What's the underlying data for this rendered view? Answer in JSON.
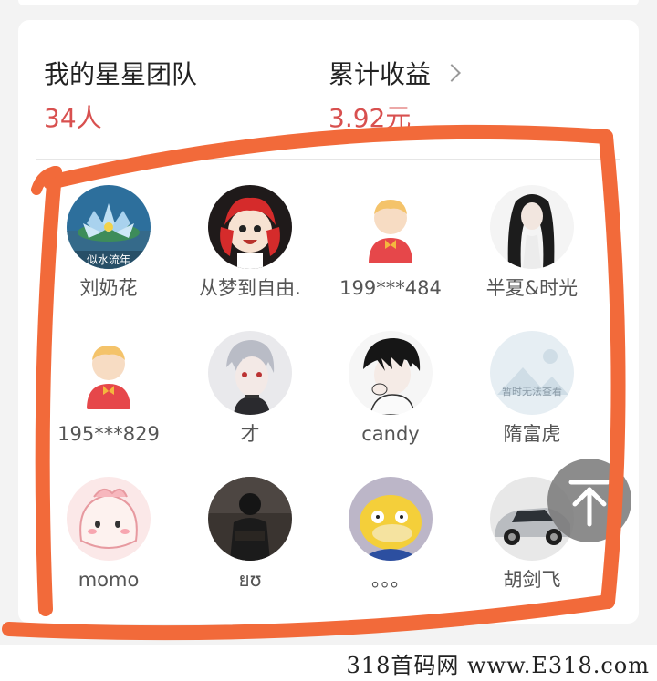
{
  "team": {
    "label": "我的星星团队",
    "count": "34人"
  },
  "earnings": {
    "label": "累计收益",
    "amount": "3.92元"
  },
  "members": [
    {
      "name": "刘奶花",
      "avatar": "lotus-avatar",
      "overlay": "似水流年"
    },
    {
      "name": "从梦到自由.",
      "avatar": "cartoon-girl-avatar"
    },
    {
      "name": "199***484",
      "avatar": "default-user-avatar"
    },
    {
      "name": "半夏&时光",
      "avatar": "ink-girl-avatar"
    },
    {
      "name": "195***829",
      "avatar": "default-user-avatar"
    },
    {
      "name": "才",
      "avatar": "anime-boy-avatar"
    },
    {
      "name": "candy",
      "avatar": "manga-boy-avatar"
    },
    {
      "name": "隋富虎",
      "avatar": "placeholder-image-avatar",
      "overlay": "暂时无法查看"
    },
    {
      "name": "momo",
      "avatar": "pink-blob-avatar"
    },
    {
      "name": "ยʊ",
      "avatar": "dark-photo-avatar"
    },
    {
      "name": "。。。",
      "avatar": "psyduck-avatar"
    },
    {
      "name": "胡剑飞",
      "avatar": "car-avatar"
    }
  ],
  "colors": {
    "accent": "#d8504f",
    "annotation": "#f26a3a"
  },
  "watermark": "318首码网  www.E318.com",
  "back_to_top": "back-to-top-arrow-icon"
}
